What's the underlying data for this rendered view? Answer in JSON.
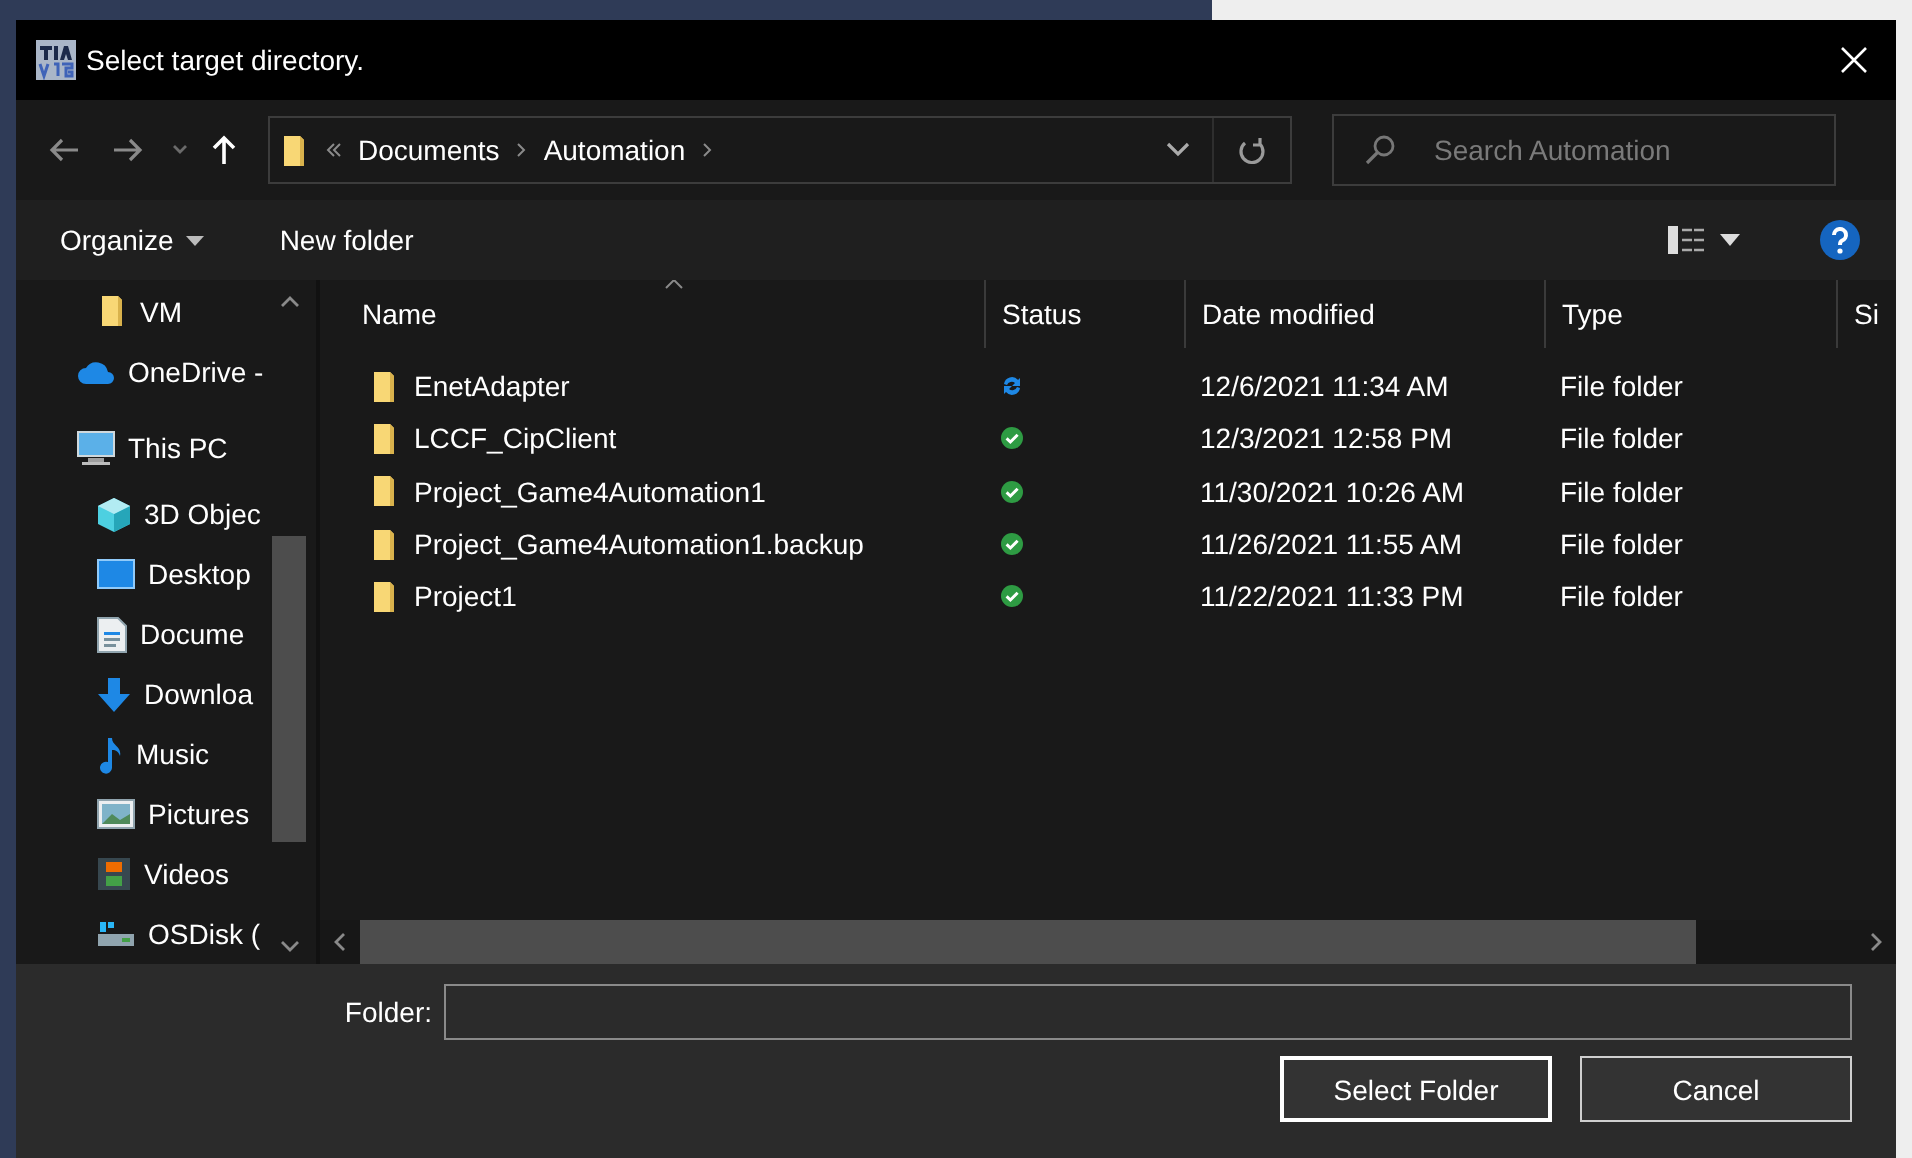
{
  "window": {
    "title": "Select target directory."
  },
  "nav": {
    "breadcrumb": [
      {
        "label": "Documents"
      },
      {
        "label": "Automation"
      }
    ],
    "search": {
      "placeholder": "Search Automation"
    }
  },
  "toolbar": {
    "organize": "Organize",
    "new_folder": "New folder"
  },
  "sidebar": {
    "items": [
      {
        "label": "VM",
        "kind": "folder"
      },
      {
        "label": "OneDrive -",
        "kind": "cloud"
      },
      {
        "label": "This PC",
        "kind": "pc",
        "children": [
          {
            "label": "3D Objec",
            "kind": "cube"
          },
          {
            "label": "Desktop",
            "kind": "desktop"
          },
          {
            "label": "Docume",
            "kind": "document"
          },
          {
            "label": "Downloa",
            "kind": "download"
          },
          {
            "label": "Music",
            "kind": "music"
          },
          {
            "label": "Pictures",
            "kind": "pictures"
          },
          {
            "label": "Videos",
            "kind": "videos"
          },
          {
            "label": "OSDisk (",
            "kind": "disk"
          }
        ]
      }
    ]
  },
  "table": {
    "columns": [
      "Name",
      "Status",
      "Date modified",
      "Type",
      "Si"
    ],
    "rows": [
      {
        "name": "EnetAdapter",
        "syncing": true,
        "date": "12/6/2021 11:34 AM",
        "type": "File folder"
      },
      {
        "name": "LCCF_CipClient",
        "syncing": false,
        "date": "12/3/2021 12:58 PM",
        "type": "File folder"
      },
      {
        "name": "Project_Game4Automation1",
        "syncing": false,
        "date": "11/30/2021 10:26 AM",
        "type": "File folder"
      },
      {
        "name": "Project_Game4Automation1.backup",
        "syncing": false,
        "date": "11/26/2021 11:55 AM",
        "type": "File folder"
      },
      {
        "name": "Project1",
        "syncing": false,
        "date": "11/22/2021 11:33 PM",
        "type": "File folder"
      }
    ]
  },
  "footer": {
    "label": "Folder:",
    "buttons": [
      {
        "label": "Select Folder",
        "default": true
      },
      {
        "label": "Cancel",
        "default": false
      }
    ]
  }
}
